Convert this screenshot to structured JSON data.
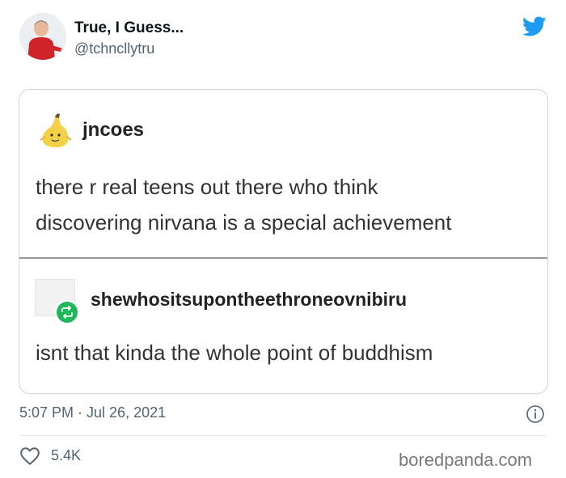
{
  "tweet": {
    "author": {
      "display_name": "True, I Guess...",
      "handle": "@tchncllytru",
      "avatar_icon": "person-photo-avatar"
    },
    "platform_icon": "twitter-bird-icon",
    "brand_color": "#1d9bf0",
    "embedded_image": {
      "post1": {
        "username": "jncoes",
        "avatar_icon": "banana-character-avatar",
        "text_line1": "there r real teens out there who think",
        "text_line2": "discovering nirvana is a special achievement"
      },
      "post2": {
        "username": "shewhositsupontheethroneovnibiru",
        "avatar_icon": "blank-avatar",
        "badge_icon": "reblog-icon",
        "badge_color": "#20b75a",
        "text": "isnt that kinda the whole point of buddhism"
      }
    },
    "timestamp": "5:07 PM · Jul 26, 2021",
    "likes": "5.4K",
    "watermark": "boredpanda.com"
  }
}
